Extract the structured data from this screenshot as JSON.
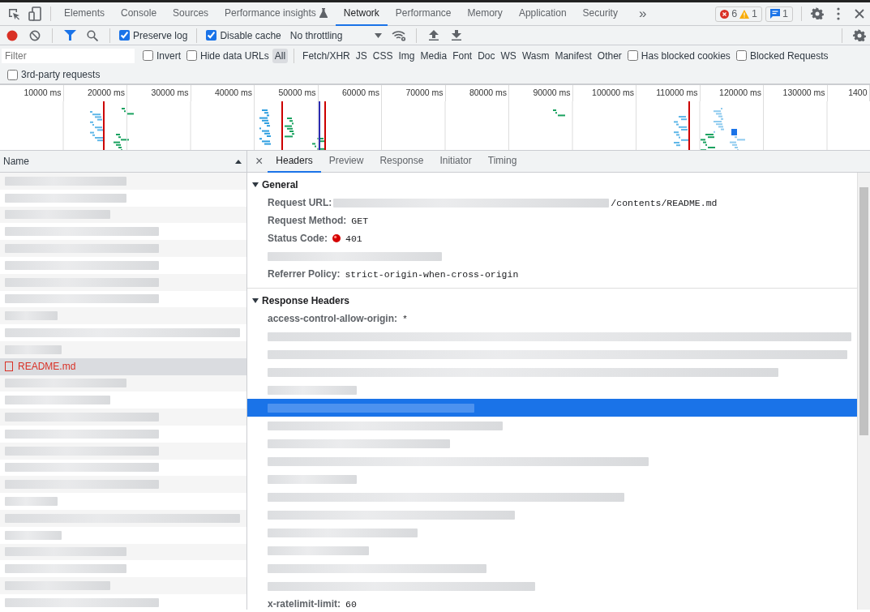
{
  "main_tabs": [
    {
      "label": "Elements",
      "selected": false
    },
    {
      "label": "Console",
      "selected": false
    },
    {
      "label": "Sources",
      "selected": false
    },
    {
      "label": "Performance insights",
      "selected": false,
      "experimental": true
    },
    {
      "label": "Network",
      "selected": true
    },
    {
      "label": "Performance",
      "selected": false
    },
    {
      "label": "Memory",
      "selected": false
    },
    {
      "label": "Application",
      "selected": false
    },
    {
      "label": "Security",
      "selected": false
    }
  ],
  "more_tabs": "»",
  "issue_counts": {
    "errors": "6",
    "warnings": "1",
    "messages": "1"
  },
  "toolbar": {
    "recording": true,
    "preserve_log": {
      "label": "Preserve log",
      "checked": true
    },
    "disable_cache": {
      "label": "Disable cache",
      "checked": true
    },
    "throttling": "No throttling"
  },
  "filter": {
    "placeholder": "Filter",
    "invert": {
      "label": "Invert",
      "checked": false
    },
    "hide_data_urls": {
      "label": "Hide data URLs",
      "checked": false
    },
    "types": [
      {
        "label": "All",
        "selected": true
      },
      {
        "label": "Fetch/XHR",
        "selected": false
      },
      {
        "label": "JS",
        "selected": false
      },
      {
        "label": "CSS",
        "selected": false
      },
      {
        "label": "Img",
        "selected": false
      },
      {
        "label": "Media",
        "selected": false
      },
      {
        "label": "Font",
        "selected": false
      },
      {
        "label": "Doc",
        "selected": false
      },
      {
        "label": "WS",
        "selected": false
      },
      {
        "label": "Wasm",
        "selected": false
      },
      {
        "label": "Manifest",
        "selected": false
      },
      {
        "label": "Other",
        "selected": false
      }
    ],
    "has_blocked_cookies": {
      "label": "Has blocked cookies",
      "checked": false
    },
    "blocked_requests": {
      "label": "Blocked Requests",
      "checked": false
    },
    "third_party": {
      "label": "3rd-party requests",
      "checked": false
    }
  },
  "overview_ticks": [
    "10000 ms",
    "20000 ms",
    "30000 ms",
    "40000 ms",
    "50000 ms",
    "60000 ms",
    "70000 ms",
    "80000 ms",
    "90000 ms",
    "100000 ms",
    "110000 ms",
    "120000 ms",
    "130000 ms",
    "1400"
  ],
  "requests": {
    "column": "Name",
    "rows": [
      {
        "kind": "redacted",
        "selected": false
      },
      {
        "kind": "redacted",
        "selected": false
      },
      {
        "kind": "redacted",
        "selected": false
      },
      {
        "kind": "redacted",
        "selected": false
      },
      {
        "kind": "redacted",
        "selected": false
      },
      {
        "kind": "redacted",
        "selected": false
      },
      {
        "kind": "redacted",
        "selected": false
      },
      {
        "kind": "redacted",
        "selected": false
      },
      {
        "kind": "redacted",
        "selected": false
      },
      {
        "kind": "redacted",
        "selected": false
      },
      {
        "kind": "redacted",
        "selected": false
      },
      {
        "kind": "request",
        "name": "README.md",
        "failed": true,
        "selected": true
      },
      {
        "kind": "redacted",
        "selected": false
      },
      {
        "kind": "redacted",
        "selected": false
      },
      {
        "kind": "redacted",
        "selected": false
      },
      {
        "kind": "redacted",
        "selected": false
      },
      {
        "kind": "redacted",
        "selected": false
      },
      {
        "kind": "redacted",
        "selected": false
      },
      {
        "kind": "redacted",
        "selected": false
      },
      {
        "kind": "redacted",
        "selected": false
      },
      {
        "kind": "redacted",
        "selected": false
      },
      {
        "kind": "redacted",
        "selected": false
      },
      {
        "kind": "redacted",
        "selected": false
      },
      {
        "kind": "redacted",
        "selected": false
      },
      {
        "kind": "redacted",
        "selected": false
      },
      {
        "kind": "redacted",
        "selected": false
      }
    ]
  },
  "detail_tabs": [
    {
      "label": "Headers",
      "selected": true
    },
    {
      "label": "Preview",
      "selected": false
    },
    {
      "label": "Response",
      "selected": false
    },
    {
      "label": "Initiator",
      "selected": false
    },
    {
      "label": "Timing",
      "selected": false
    }
  ],
  "close": "×",
  "general": {
    "title": "General",
    "expanded": true,
    "rows": [
      {
        "kind": "field",
        "name": "Request URL:",
        "value_tail": "/contents/README.md"
      },
      {
        "kind": "field",
        "name": "Request Method:",
        "value": "GET"
      },
      {
        "kind": "status",
        "name": "Status Code:",
        "value": "401"
      },
      {
        "kind": "redacted"
      },
      {
        "kind": "field",
        "name": "Referrer Policy:",
        "value": "strict-origin-when-cross-origin"
      }
    ]
  },
  "response_headers": {
    "title": "Response Headers",
    "expanded": true,
    "rows": [
      {
        "kind": "header",
        "name": "access-control-allow-origin:",
        "value": "*",
        "selected": false
      },
      {
        "kind": "redacted",
        "selected": false
      },
      {
        "kind": "redacted",
        "selected": false
      },
      {
        "kind": "redacted",
        "selected": false
      },
      {
        "kind": "redacted",
        "selected": false
      },
      {
        "kind": "redacted",
        "selected": true
      },
      {
        "kind": "redacted",
        "selected": false
      },
      {
        "kind": "redacted",
        "selected": false
      },
      {
        "kind": "redacted",
        "selected": false
      },
      {
        "kind": "redacted",
        "selected": false
      },
      {
        "kind": "redacted",
        "selected": false
      },
      {
        "kind": "redacted",
        "selected": false
      },
      {
        "kind": "redacted",
        "selected": false
      },
      {
        "kind": "redacted",
        "selected": false
      },
      {
        "kind": "redacted",
        "selected": false
      },
      {
        "kind": "redacted",
        "selected": false
      },
      {
        "kind": "header",
        "name": "x-ratelimit-limit:",
        "value": "60",
        "selected": false
      }
    ]
  }
}
